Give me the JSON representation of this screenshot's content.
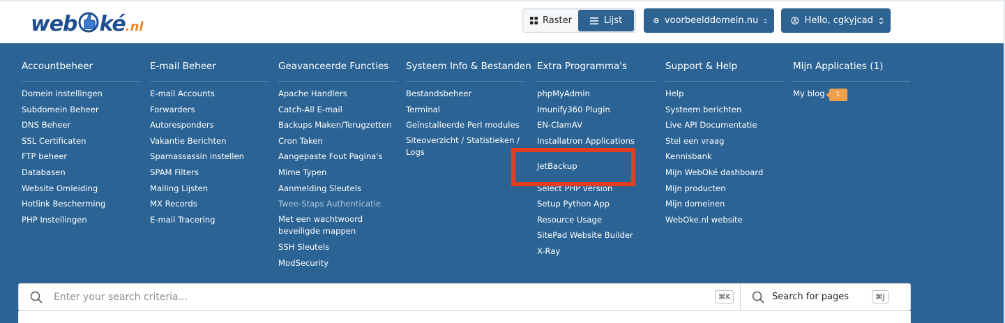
{
  "brand": {
    "logo_main": "web",
    "logo_tail": "ké",
    "logo_tld": ".nl",
    "color_primary": "#2b6394",
    "color_logo": "#1f4f91",
    "color_logo_accent": "#e8892b"
  },
  "header": {
    "view_grid_label": "Raster",
    "view_list_label": "Lijst",
    "domain_label": "voorbeelddomein.nu",
    "user_label": "Hello, cgkyjcad"
  },
  "menu": {
    "columns": [
      {
        "title": "Accountbeheer",
        "items": [
          "Domein instellingen",
          "Subdomein Beheer",
          "DNS Beheer",
          "SSL Certificaten",
          "FTP beheer",
          "Databasen",
          "Website Omleiding",
          "Hotlink Bescherming",
          "PHP Instellingen"
        ]
      },
      {
        "title": "E-mail Beheer",
        "items": [
          "E-mail Accounts",
          "Forwarders",
          "Autoresponders",
          "Vakantie Berichten",
          "Spamassassin instellen",
          "SPAM Filters",
          "Mailing Lijsten",
          "MX Records",
          "E-mail Tracering"
        ]
      },
      {
        "title": "Geavanceerde Functies",
        "items": [
          "Apache Handlers",
          "Catch-All E-mail",
          "Backups Maken/Terugzetten",
          "Cron Taken",
          "Aangepaste Fout Pagina's",
          "Mime Typen",
          "Aanmelding Sleutels",
          "Twee-Staps Authenticatie",
          "Met een wachtwoord beveiligde mappen",
          "SSH Sleutels",
          "ModSecurity"
        ]
      },
      {
        "title": "Systeem Info & Bestanden",
        "items": [
          "Bestandsbeheer",
          "Terminal",
          "Geïnstalleerde Perl modules",
          "Siteoverzicht / Statistieken / Logs"
        ]
      },
      {
        "title": "Extra Programma's",
        "items": [
          "phpMyAdmin",
          "Imunify360 Plugin",
          "EN-ClamAV",
          "Installatron Applications",
          "JetBackup",
          "",
          "Select PHP version",
          "Setup Python App",
          "Resource Usage",
          "SitePad Website Builder",
          "X-Ray"
        ]
      },
      {
        "title": "Support & Help",
        "items": [
          "Help",
          "Systeem berichten",
          "Live API Documentatie",
          "Stel een vraag",
          "Kennisbank",
          "Mijn WebOké dashboard",
          "Mijn producten",
          "Mijn domeinen",
          "WebOke.nl website"
        ]
      },
      {
        "title": "Mijn Applicaties (1)",
        "items": [
          "My blog"
        ],
        "badge": "1"
      }
    ]
  },
  "search": {
    "placeholder": "Enter your search criteria...",
    "shortcut": "⌘K",
    "pages_label": "Search for pages",
    "pages_shortcut": "⌘J"
  }
}
